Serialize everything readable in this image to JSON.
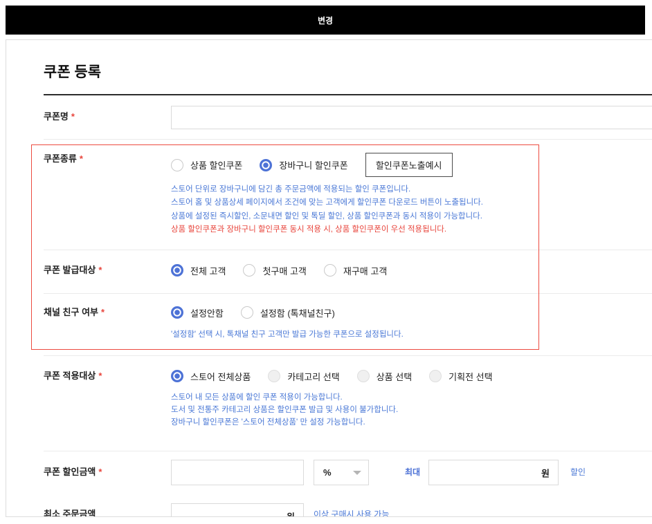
{
  "top_bar": {
    "title": "변경"
  },
  "page_title": "쿠폰 등록",
  "required_mark": "*",
  "fields": {
    "coupon_name": {
      "label": "쿠폰명",
      "value": ""
    },
    "coupon_type": {
      "label": "쿠폰종류",
      "options": [
        {
          "label": "상품 할인쿠폰",
          "selected": false
        },
        {
          "label": "장바구니 할인쿠폰",
          "selected": true
        }
      ],
      "preview_button": "할인쿠폰노출예시",
      "help": [
        "스토어 단위로 장바구니에 담긴 총 주문금액에 적용되는 할인 쿠폰입니다.",
        "스토어 홈 및 상품상세 페이지에서 조건에 맞는 고객에게 할인쿠폰 다운로드 버튼이 노출됩니다.",
        "상품에 설정된 즉시할인, 소문내면 할인 및 톡딜 할인, 상품 할인쿠폰과 동시 적용이 가능합니다."
      ],
      "warning": "상품 할인쿠폰과 장바구니 할인쿠폰 동시 적용 시, 상품 할인쿠폰이 우선 적용됩니다."
    },
    "issue_target": {
      "label": "쿠폰 발급대상",
      "options": [
        {
          "label": "전체 고객",
          "selected": true
        },
        {
          "label": "첫구매 고객",
          "selected": false
        },
        {
          "label": "재구매 고객",
          "selected": false
        }
      ]
    },
    "channel_friend": {
      "label": "채널 친구 여부",
      "options": [
        {
          "label": "설정안함",
          "selected": true
        },
        {
          "label": "설정함 (톡채널친구)",
          "selected": false
        }
      ],
      "help": [
        "'설정함' 선택 시, 톡채널 친구 고객만 발급 가능한 쿠폰으로 설정됩니다."
      ]
    },
    "apply_target": {
      "label": "쿠폰 적용대상",
      "options": [
        {
          "label": "스토어 전체상품",
          "selected": true,
          "disabled": false
        },
        {
          "label": "카테고리 선택",
          "selected": false,
          "disabled": true
        },
        {
          "label": "상품 선택",
          "selected": false,
          "disabled": true
        },
        {
          "label": "기획전 선택",
          "selected": false,
          "disabled": true
        }
      ],
      "help": [
        "스토어 내 모든 상품에 할인 쿠폰 적용이 가능합니다.",
        "도서 및 전통주 카테고리 상품은 할인쿠폰 발급 및 사용이 불가합니다.",
        "장바구니 할인쿠폰은 '스토어 전체상품' 만 설정 가능합니다."
      ]
    },
    "discount_amount": {
      "label": "쿠폰 할인금액",
      "value": "",
      "unit_select": "%",
      "max_label": "최대",
      "max_value": "",
      "max_unit": "원",
      "suffix": "할인"
    },
    "min_order": {
      "label": "최소 주문금액",
      "value": "",
      "unit": "원",
      "suffix": "이상 구매시 사용 가능"
    }
  },
  "colors": {
    "accent": "#4d72d6",
    "help_text": "#4a78d6",
    "warning": "#e8453c",
    "highlight_border": "#ec4a3f",
    "top_bar": "#000000"
  }
}
